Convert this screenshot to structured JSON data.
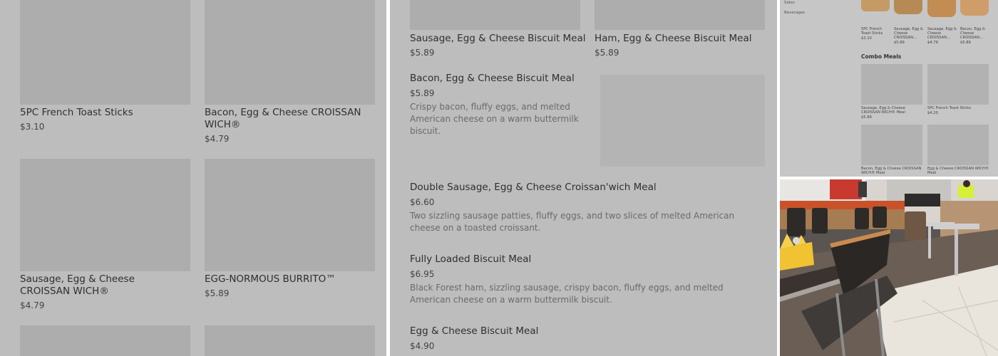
{
  "left_panel": {
    "items": [
      {
        "name": "5PC French Toast Sticks",
        "price": "$3.10"
      },
      {
        "name": "Bacon, Egg & Cheese CROISSAN WICH®",
        "price": "$4.79"
      },
      {
        "name": "Sausage, Egg & Cheese CROISSAN WICH®",
        "price": "$4.79"
      },
      {
        "name": "EGG-NORMOUS BURRITO™",
        "price": "$5.89"
      }
    ]
  },
  "middle_panel": {
    "top_items": [
      {
        "name": "Sausage, Egg & Cheese Biscuit Meal",
        "price": "$5.89"
      },
      {
        "name": "Ham, Egg & Cheese Biscuit Meal",
        "price": "$5.89"
      }
    ],
    "list_items": [
      {
        "name": "Bacon, Egg & Cheese Biscuit Meal",
        "price": "$5.89",
        "description": "Crispy bacon, fluffy eggs, and melted American cheese on a warm buttermilk biscuit."
      },
      {
        "name": "Double Sausage, Egg & Cheese Croissan'wich Meal",
        "price": "$6.60",
        "description": "Two sizzling sausage patties, fluffy eggs, and two slices of melted American cheese on a toasted croissant."
      },
      {
        "name": "Fully Loaded Biscuit Meal",
        "price": "$6.95",
        "description": "Black Forest ham, sizzling sausage, crispy bacon, fluffy eggs, and melted American cheese on a warm buttermilk biscuit."
      },
      {
        "name": "Egg & Cheese Biscuit Meal",
        "price": "$4.90",
        "description": ""
      }
    ]
  },
  "top_right_panel": {
    "sidebar": [
      "Sides",
      "Beverages"
    ],
    "row_items": [
      {
        "name": "5PC French Toast Sticks",
        "price": "$3.10"
      },
      {
        "name": "Sausage, Egg & Cheese CROISSAN...",
        "price": "$5.89"
      },
      {
        "name": "Sausage, Egg & Cheese CROISSAN...",
        "price": "$4.79"
      },
      {
        "name": "Bacon, Egg & Cheese CROISSAN...",
        "price": "$5.89"
      }
    ],
    "section_title": "Combo Meals",
    "combo_items": [
      {
        "name": "Sausage, Egg & Cheese CROISSAN WICH® Meal",
        "price": "$5.89"
      },
      {
        "name": "5PC French Toast Sticks",
        "price": "$4.20"
      },
      {
        "name": "Bacon, Egg & Cheese CROISSAN WICH® Meal",
        "price": ""
      },
      {
        "name": "Egg & Cheese CROISSAN WICH® Meal",
        "price": ""
      }
    ]
  },
  "colors": {
    "overlay_gray": "#bdbdbd",
    "placeholder_gray": "#adadad",
    "crown_yellow": "#f1c232"
  }
}
